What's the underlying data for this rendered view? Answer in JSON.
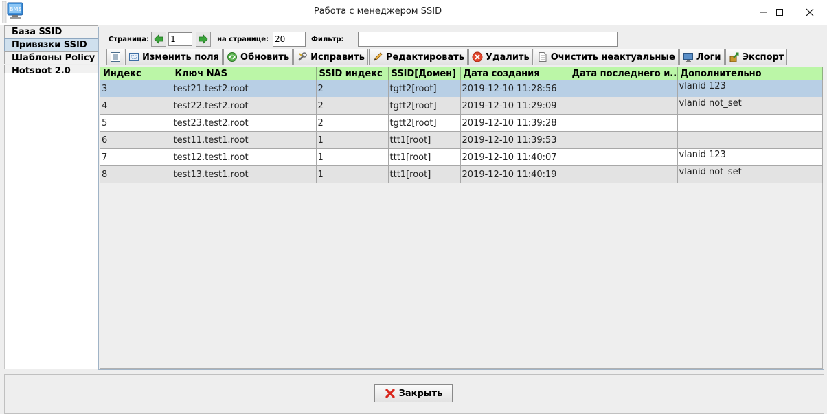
{
  "window": {
    "title": "Работа с менеджером SSID",
    "minimize": "—",
    "maximize": "☐",
    "close": "✕"
  },
  "left_tabs": [
    {
      "label": "База SSID",
      "active": false
    },
    {
      "label": "Привязки SSID",
      "active": true
    },
    {
      "label": "Шаблоны Policy",
      "active": false
    },
    {
      "label": "Hotspot 2.0",
      "active": false
    }
  ],
  "pager": {
    "page_label": "Страница:",
    "page_value": "1",
    "per_page_label": "на странице:",
    "per_page_value": "20",
    "filter_label": "Фильтр:",
    "filter_value": ""
  },
  "toolbar": {
    "columns_icon": "columns-icon",
    "edit_fields": "Изменить поля",
    "refresh": "Обновить",
    "fix": "Исправить",
    "edit": "Редактировать",
    "delete": "Удалить",
    "clear_stale": "Очистить неактуальные",
    "logs": "Логи",
    "export": "Экспорт"
  },
  "table": {
    "columns": [
      "Индекс",
      "Ключ NAS",
      "SSID индекс",
      "SSID[Домен]",
      "Дата создания",
      "Дата последнего и...",
      "Дополнительно"
    ],
    "rows": [
      [
        "3",
        "test21.test2.root",
        "2",
        "tgtt2[root]",
        "2019-12-10 11:28:56",
        "",
        "vlanid 123"
      ],
      [
        "4",
        "test22.test2.root",
        "2",
        "tgtt2[root]",
        "2019-12-10 11:29:09",
        "",
        "vlanid not_set"
      ],
      [
        "5",
        "test23.test2.root",
        "2",
        "tgtt2[root]",
        "2019-12-10 11:39:28",
        "",
        ""
      ],
      [
        "6",
        "test11.test1.root",
        "1",
        "ttt1[root]",
        "2019-12-10 11:39:53",
        "",
        ""
      ],
      [
        "7",
        "test12.test1.root",
        "1",
        "ttt1[root]",
        "2019-12-10 11:40:07",
        "",
        "vlanid 123"
      ],
      [
        "8",
        "test13.test1.root",
        "1",
        "ttt1[root]",
        "2019-12-10 11:40:19",
        "",
        "vlanid not_set"
      ]
    ],
    "selected_row": 0
  },
  "footer": {
    "close_label": "Закрыть"
  },
  "colors": {
    "header_green": "#bbf6a7",
    "selection": "#b8cfe5",
    "stripe": "#e3e3e3"
  }
}
